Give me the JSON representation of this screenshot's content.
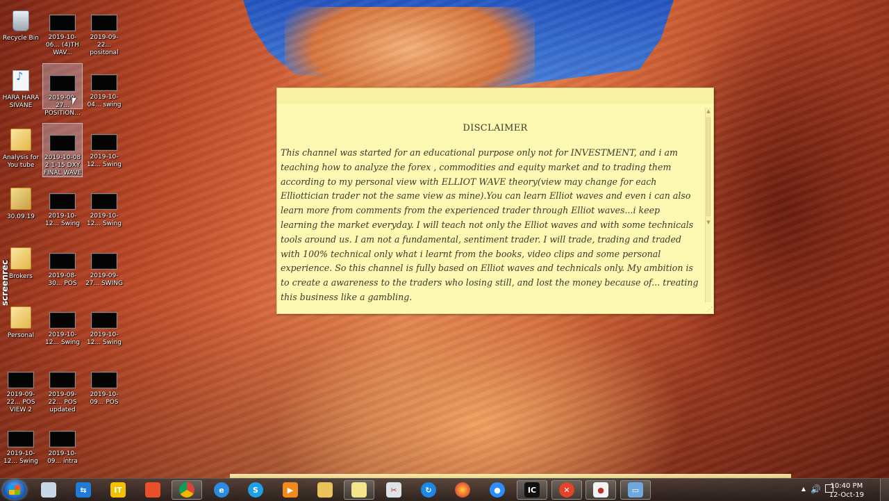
{
  "desktop": {
    "icons": [
      {
        "id": "recycle-bin",
        "label": "Recycle Bin",
        "kind": "bin"
      },
      {
        "id": "i1",
        "label": "2019-10-06... (4)TH WAV...",
        "kind": "thumb"
      },
      {
        "id": "i2",
        "label": "2019-09-22... positonal",
        "kind": "thumb"
      },
      {
        "id": "hara",
        "label": "HARA HARA SIVANE",
        "kind": "mp3"
      },
      {
        "id": "i3",
        "label": "2019-09-27... POSITION...",
        "kind": "thumb"
      },
      {
        "id": "i4",
        "label": "2019-10-04... swing",
        "kind": "thumb"
      },
      {
        "id": "analysis",
        "label": "Analysis for You tube",
        "kind": "folder"
      },
      {
        "id": "i5",
        "label": "2019-10-08 2 1-15 DXY FINAL WAVE",
        "kind": "thumb"
      },
      {
        "id": "i6",
        "label": "2019-10-12... Swing",
        "kind": "thumb"
      },
      {
        "id": "f3009",
        "label": "30.09.19",
        "kind": "folder"
      },
      {
        "id": "i7",
        "label": "2019-10-12... Swing",
        "kind": "thumb"
      },
      {
        "id": "i8",
        "label": "2019-10-12... Swing",
        "kind": "thumb"
      },
      {
        "id": "brokers",
        "label": "Brokers",
        "kind": "folder"
      },
      {
        "id": "i9",
        "label": "2019-08-30... POS",
        "kind": "thumb"
      },
      {
        "id": "i10",
        "label": "2019-09-27... SWING",
        "kind": "thumb"
      },
      {
        "id": "personal",
        "label": "Personal",
        "kind": "folder"
      },
      {
        "id": "i11",
        "label": "2019-10-12... Swing",
        "kind": "thumb"
      },
      {
        "id": "i12",
        "label": "2019-10-12... Swing",
        "kind": "thumb"
      },
      {
        "id": "i13",
        "label": "2019-09-22... POS VIEW 2",
        "kind": "thumb"
      },
      {
        "id": "i14",
        "label": "2019-09-22... POS updated",
        "kind": "thumb"
      },
      {
        "id": "i15",
        "label": "2019-10-09... POS",
        "kind": "thumb"
      },
      {
        "id": "i16",
        "label": "2019-10-12... Swing",
        "kind": "thumb"
      },
      {
        "id": "i17",
        "label": "2019-10-09... intra",
        "kind": "thumb"
      }
    ],
    "watermark": "screenrec"
  },
  "note": {
    "title": "DISCLAIMER",
    "body": "This channel was started for an educational purpose only not for INVESTMENT, and i am teaching how to analyze the forex , commodities and equity market and to trading them according to my personal view with ELLIOT WAVE theory(view may change for each Elliottician trader not the same view as mine).You can learn Elliot waves and even i can also learn more from  comments from the experienced trader through Elliot waves...i keep learning the market everyday. I will teach not only the Elliot waves and with some technicals tools around us. I am not a fundamental, sentiment trader. I will trade, trading and traded with 100% technical only what i learnt from the books, video clips and some personal experience. So this channel is fully based on Elliot waves and technicals only. My ambition is to create a awareness to the traders who losing still, and lost the money because of... treating this business like a gambling."
  },
  "taskbar": {
    "apps": [
      {
        "name": "paint-app",
        "color": "#c9d8e8",
        "glyph": "",
        "active": false
      },
      {
        "name": "teamviewer-app",
        "color": "#1f7bd8",
        "glyph": "⇆",
        "active": false
      },
      {
        "name": "it-app",
        "color": "#f2c200",
        "glyph": "IT",
        "active": false
      },
      {
        "name": "tool-app",
        "color": "#e8502a",
        "glyph": "",
        "active": false
      },
      {
        "name": "chrome-app",
        "color": "#2fa04a",
        "glyph": "",
        "active": true
      },
      {
        "name": "ie-app",
        "color": "#2c8be0",
        "glyph": "e",
        "active": false
      },
      {
        "name": "skype-app",
        "color": "#1ea0e8",
        "glyph": "S",
        "active": false
      },
      {
        "name": "media-app",
        "color": "#f08a1c",
        "glyph": "▶",
        "active": false
      },
      {
        "name": "explorer-app",
        "color": "#e9c35a",
        "glyph": "",
        "active": false
      },
      {
        "name": "notes-app",
        "color": "#f2e58c",
        "glyph": "",
        "active": true
      },
      {
        "name": "snipping-app",
        "color": "#dfe3e8",
        "glyph": "✂",
        "active": false
      },
      {
        "name": "sync-app",
        "color": "#1e88e5",
        "glyph": "↻",
        "active": false
      },
      {
        "name": "firefox-app",
        "color": "#e8612c",
        "glyph": "",
        "active": false
      },
      {
        "name": "zoom-app",
        "color": "#2d8cff",
        "glyph": "●",
        "active": false
      },
      {
        "name": "trading-app",
        "color": "#111111",
        "glyph": "IC",
        "active": true
      },
      {
        "name": "xmind-app",
        "color": "#e2452a",
        "glyph": "✕",
        "active": true
      },
      {
        "name": "recorder-app",
        "color": "#f2f2f2",
        "glyph": "●",
        "active": true
      },
      {
        "name": "monitor-app",
        "color": "#6fa8dc",
        "glyph": "▭",
        "active": true
      }
    ],
    "clock_time": "10:40 PM",
    "clock_date": "12-Oct-19"
  }
}
